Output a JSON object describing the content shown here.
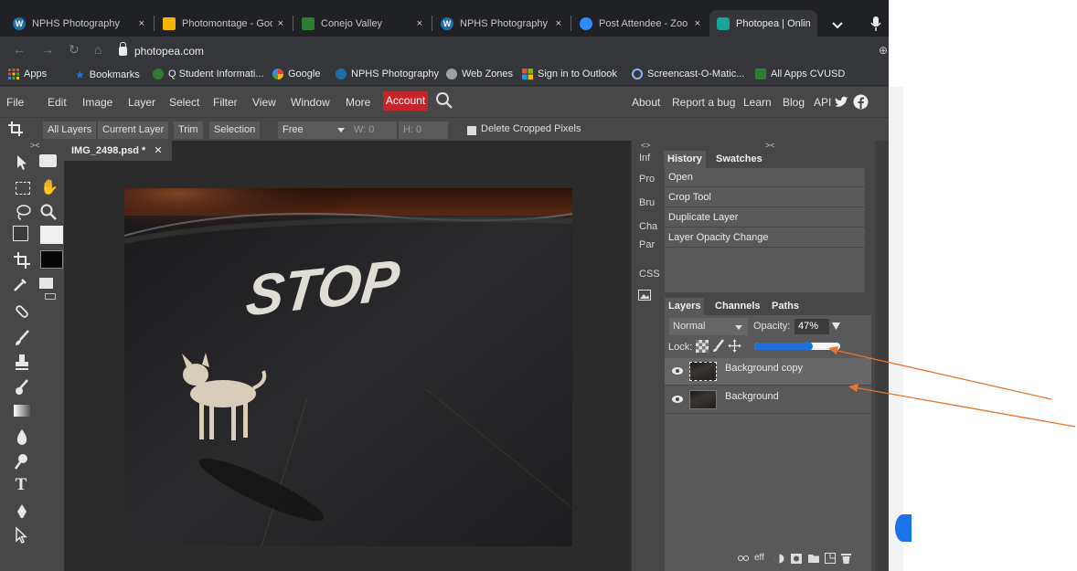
{
  "browser": {
    "tabs": [
      {
        "label": "NPHS Photography",
        "icon_color": "#1e6fa8",
        "icon_glyph": "W",
        "active": false
      },
      {
        "label": "Photomontage - Goo",
        "icon_color": "#f4b400",
        "icon_glyph": "",
        "active": false
      },
      {
        "label": "Conejo Valley",
        "icon_color": "#2e7d32",
        "icon_glyph": "",
        "active": false
      },
      {
        "label": "NPHS Photography",
        "icon_color": "#1e6fa8",
        "icon_glyph": "W",
        "active": false
      },
      {
        "label": "Post Attendee - Zoo",
        "icon_color": "#2d8cff",
        "icon_glyph": "",
        "active": false
      },
      {
        "label": "Photopea | Online P",
        "icon_color": "#18a497",
        "icon_glyph": "",
        "active": true
      }
    ],
    "tab_close": "×",
    "url": "photopea.com",
    "bookmarks": [
      {
        "label": "Apps",
        "icon": "apps-grid-icon",
        "color": "#ea4335"
      },
      {
        "label": "Bookmarks",
        "icon": "star-icon",
        "color": "#1a73e8"
      },
      {
        "label": "Q Student Informati...",
        "icon": "q-logo-icon",
        "color": "#2e7d32"
      },
      {
        "label": "Google",
        "icon": "google-icon",
        "color": "#fbbc05"
      },
      {
        "label": "NPHS Photography",
        "icon": "wordpress-icon",
        "color": "#1e6fa8"
      },
      {
        "label": "Web Zones",
        "icon": "globe-icon",
        "color": "#9aa0a6"
      },
      {
        "label": "Sign in to Outlook",
        "icon": "microsoft-icon",
        "color": "#f25022"
      },
      {
        "label": "Screencast-O-Matic...",
        "icon": "screencast-icon",
        "color": "#1a73e8"
      },
      {
        "label": "All Apps CVUSD",
        "icon": "cvusd-icon",
        "color": "#2e7d32"
      }
    ]
  },
  "photopea": {
    "menus": [
      "File",
      "Edit",
      "Image",
      "Layer",
      "Select",
      "Filter",
      "View",
      "Window",
      "More"
    ],
    "account_label": "Account",
    "right_links": [
      "About",
      "Report a bug",
      "Learn",
      "Blog",
      "API"
    ],
    "options": {
      "buttons": [
        "All Layers",
        "Current Layer",
        "Trim",
        "Selection"
      ],
      "ratio_value": "Free",
      "width_label": "W: 0",
      "height_label": "H: 0",
      "delete_cropped": "Delete Cropped Pixels"
    },
    "document_tab": "IMG_2498.psd *",
    "canvas_text": "STOP",
    "narrow_tabs": [
      "Inf",
      "Pro",
      "Bru",
      "Cha",
      "Par",
      "CSS"
    ],
    "collapse_left": "><",
    "collapse_mid": "<>",
    "collapse_right": "><",
    "history_tabs": [
      "History",
      "Swatches"
    ],
    "history": [
      "Open",
      "Crop Tool",
      "Duplicate Layer",
      "Layer Opacity Change"
    ],
    "layers_tabs": [
      "Layers",
      "Channels",
      "Paths"
    ],
    "blend_mode": "Normal",
    "opacity_label": "Opacity:",
    "opacity_value": "47%",
    "opacity_fraction": 0.47,
    "lock_label": "Lock:",
    "layers": [
      "Background copy",
      "Background"
    ],
    "footer_icons_text": [
      "eff"
    ]
  },
  "colors": {
    "account_red": "#c4242b",
    "annotation_arrow": "#e8742b",
    "slider_blue": "#1e6fd9"
  }
}
